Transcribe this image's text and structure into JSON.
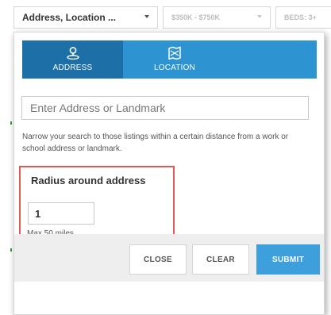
{
  "filters": {
    "location_label": "Address, Location ...",
    "price_label": "$350K - $750K",
    "beds_label": "BEDS: 3+"
  },
  "tabs": [
    {
      "label": "ADDRESS",
      "icon": "map-pin-icon",
      "active": true
    },
    {
      "label": "LOCATION",
      "icon": "folded-map-icon",
      "active": false
    }
  ],
  "address_search": {
    "placeholder": "Enter Address or Landmark",
    "value": ""
  },
  "help_text": "Narrow your search to those listings within a certain distance from a work or school address or landmark.",
  "radius": {
    "title": "Radius around address",
    "value": "1",
    "hint": "Max 50 miles"
  },
  "buttons": {
    "close": "CLOSE",
    "clear": "CLEAR",
    "submit": "SUBMIT"
  },
  "colors": {
    "tab_bar": "#2d93d1",
    "tab_active": "#1c6fa7",
    "submit": "#3da0dc",
    "highlight": "#e05a5a",
    "footer": "#eeeeee"
  }
}
